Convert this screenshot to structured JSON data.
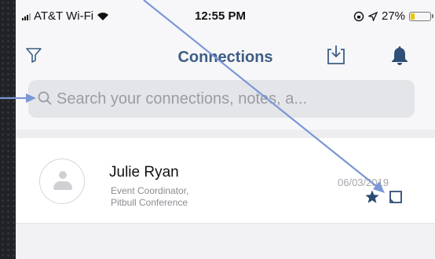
{
  "status_bar": {
    "carrier": "AT&T Wi-Fi",
    "time": "12:55 PM",
    "battery": "27%",
    "battery_level": 0.27
  },
  "nav": {
    "title": "Connections",
    "icons": [
      "filter-icon",
      "inbox-download-icon",
      "bell-icon"
    ]
  },
  "search": {
    "placeholder": "Search your connections, notes, a..."
  },
  "connections": [
    {
      "name": "Julie Ryan",
      "title_line1": "Event Coordinator,",
      "title_line2": "Pitbull Conference",
      "date": "06/03/2019",
      "starred": true
    }
  ],
  "colors": {
    "title": "#3d5d84",
    "accent": "#3d5d84",
    "annotation": "#7b97d6",
    "battery": "#f0c400",
    "bell": "#2f4f79"
  }
}
